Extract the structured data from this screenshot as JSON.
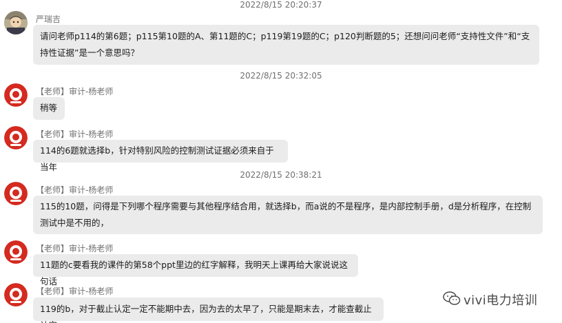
{
  "messages": [
    {
      "timestamp": "2022/8/15 20:20:37",
      "sender": "严瑞吉",
      "text": "请问老师p114的第6题；p115第10题的A、第11题的C；p119第19题的C；p120判断题的5；还想问问老师“支持性文件”和“支持性证据”是一个意思吗？"
    },
    {
      "timestamp": "2022/8/15 20:32:05",
      "sender": "【老师】审计-杨老师",
      "text": "稍等"
    },
    {
      "sender": "【老师】审计-杨老师",
      "text": "114的6题就选择b，针对特别风险的控制测试证据必须来自于当年"
    },
    {
      "timestamp": "2022/8/15 20:38:21",
      "sender": "【老师】审计-杨老师",
      "text": "115的10题，问得是下列哪个程序需要与其他程序结合用，就选择b，而a说的不是程序，是内部控制手册，d是分析程序，在控制测试中是不用的，"
    },
    {
      "sender": "【老师】审计-杨老师",
      "text": "11题的c要看我的课件的第58个ppt里边的红字解释，我明天上课再给大家说说这句话"
    },
    {
      "sender": "【老师】审计-杨老师",
      "text": "119的b，对于截止认定一定不能期中去，因为去的太早了，只能是期末去，才能查截止认定"
    }
  ],
  "watermark": {
    "text": "vivi电力培训"
  },
  "colors": {
    "bubble": "#ebebeb",
    "avatar_red": "#d42a20",
    "timestamp": "#6e6e6e"
  }
}
